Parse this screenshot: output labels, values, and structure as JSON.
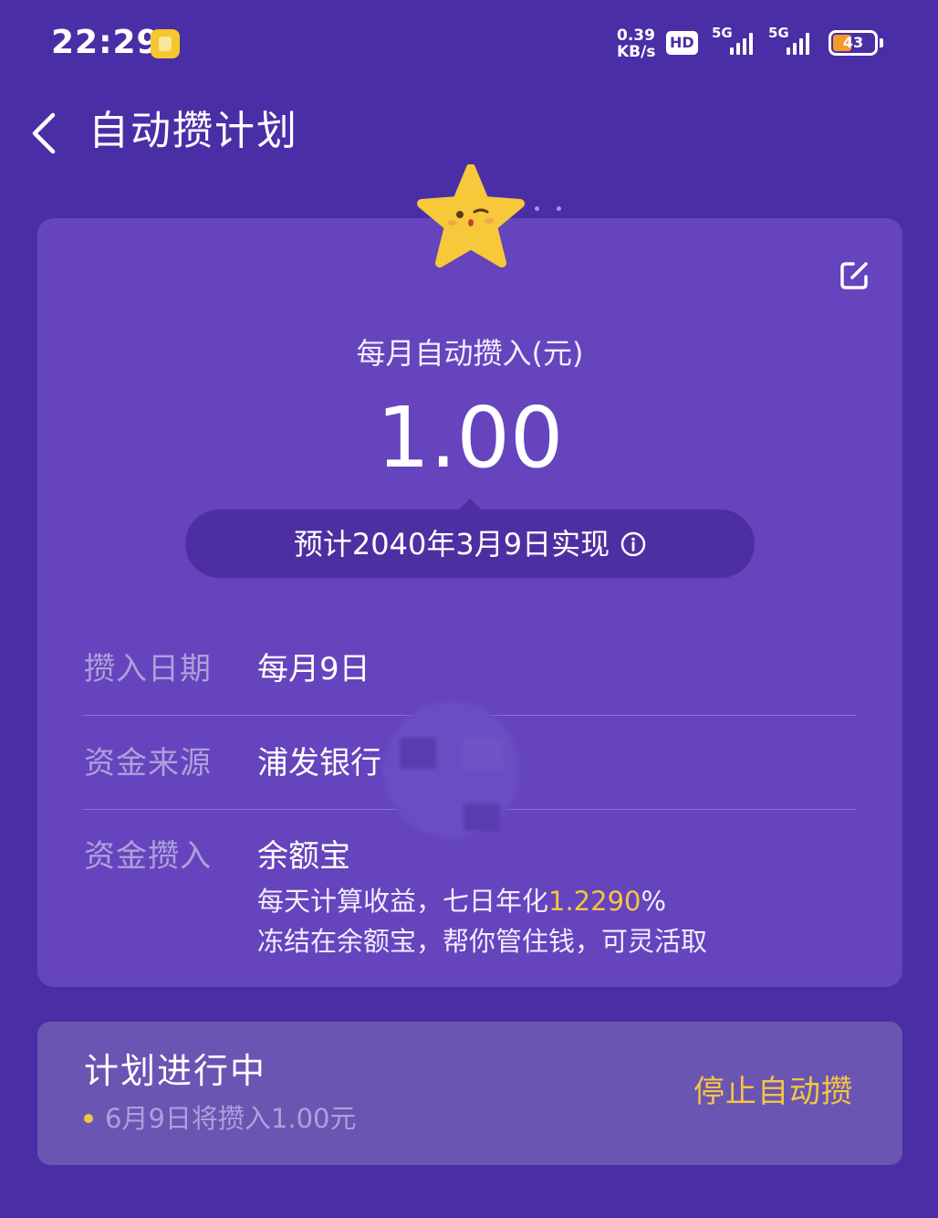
{
  "status_bar": {
    "time": "22:29",
    "net_speed_value": "0.39",
    "net_speed_unit": "KB/s",
    "hd_badge": "HD",
    "sim1_network": "5G",
    "sim2_network": "5G",
    "battery_level": "43",
    "icons": [
      "app-notification-icon",
      "signal-icon",
      "battery-icon"
    ]
  },
  "header": {
    "title": "自动攒计划",
    "back_icon": "chevron-left-icon"
  },
  "plan_summary": {
    "amount_label": "每月自动攒入(元)",
    "amount": "1.00",
    "estimate": "预计2040年3月9日实现",
    "edit_icon": "edit-icon",
    "info_icon": "info-icon",
    "mascot": "star-mascot"
  },
  "details": {
    "date_label": "攒入日期",
    "date_value": "每月9日",
    "source_label": "资金来源",
    "source_value": "浦发银行",
    "target_label": "资金攒入",
    "target_value": "余额宝",
    "yield_prefix": "每天计算收益，七日年化",
    "yield_rate": "1.2290",
    "yield_suffix": "%",
    "note": "冻结在余额宝，帮你管住钱，可灵活取"
  },
  "plan_status": {
    "status": "计划进行中",
    "next_deposit": "6月9日将攒入1.00元",
    "stop_button": "停止自动攒"
  },
  "colors": {
    "background": "#4a2ea6",
    "card": "#6544bd",
    "pill": "#4e2fa2",
    "accent_yellow": "#f5c542",
    "muted_label": "#ada0dc"
  }
}
